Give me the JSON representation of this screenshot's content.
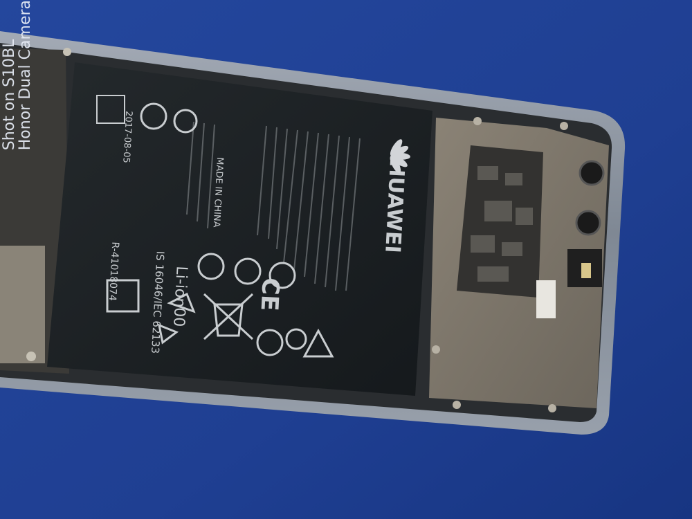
{
  "photo": {
    "subject": "Opened smartphone showing battery and mainboard",
    "watermark": {
      "line1": "Shot on S10BL",
      "line2": "Honor Dual Camera"
    },
    "battery": {
      "brand": "HUAWEI",
      "date_code": "2017-08-05",
      "chemistry": "Li-ion00",
      "standard": "IS 16046/IEC 62133",
      "ce_mark": "CE",
      "origin": "MADE IN CHINA",
      "reg_no": "R-41018074"
    },
    "colors": {
      "background": "#1e3f95",
      "frame": "#8e97a3",
      "battery": "#1b1f22",
      "shield": "#7b7468"
    }
  }
}
